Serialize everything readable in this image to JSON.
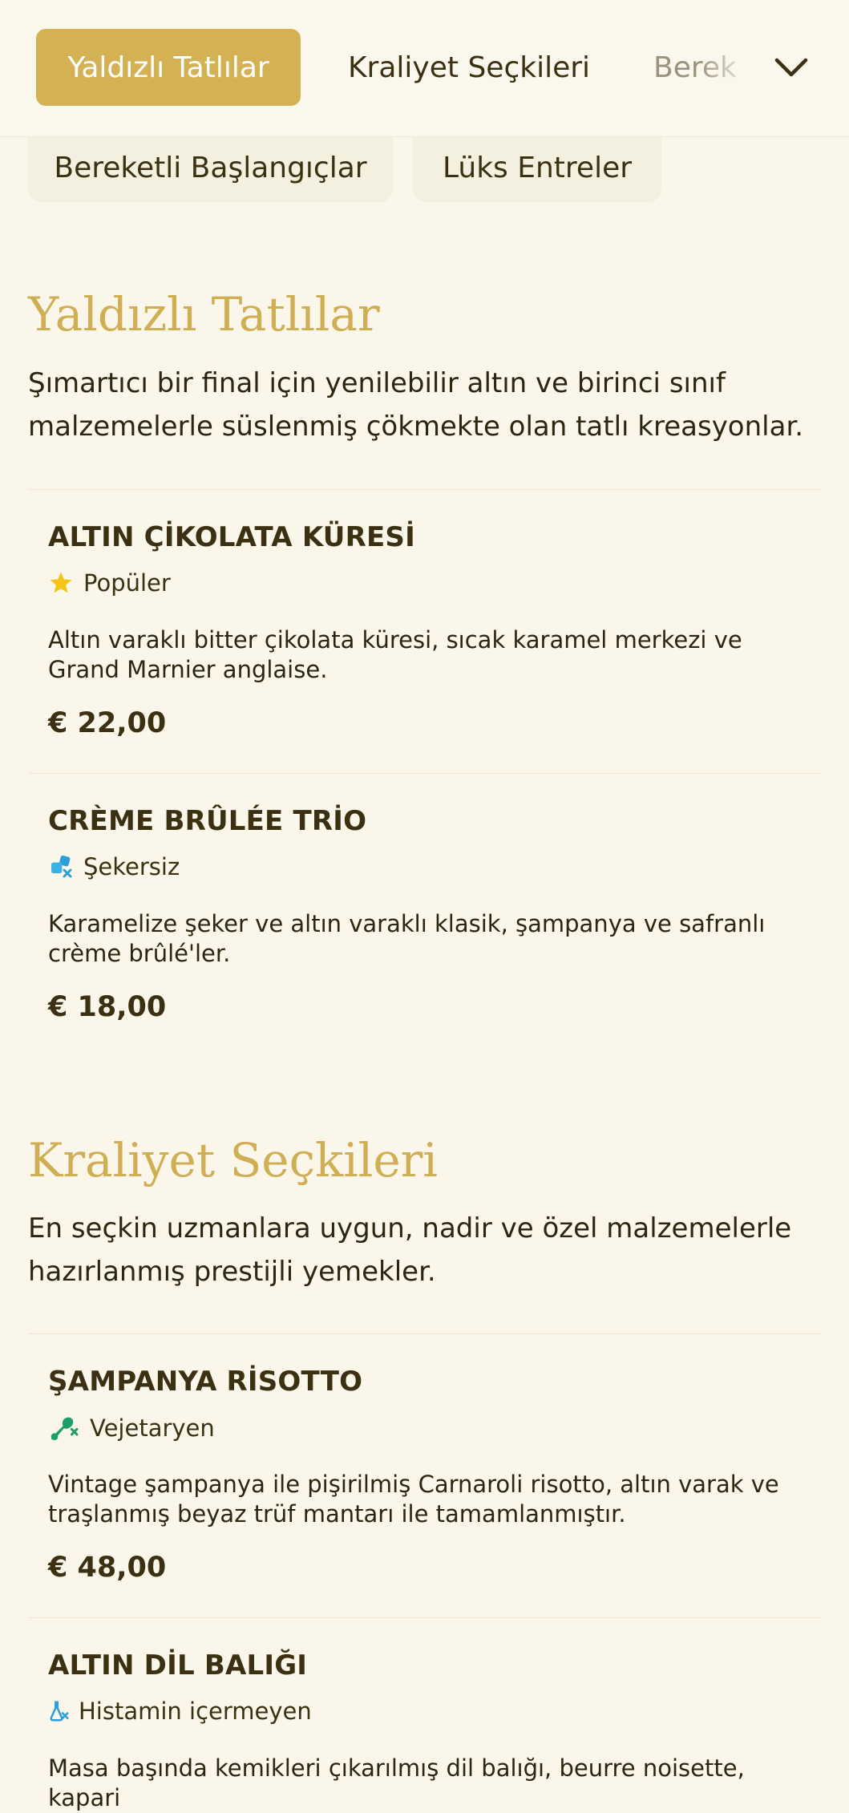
{
  "top_tabs": [
    {
      "label": "Yaldızlı Tatlılar",
      "active": true
    },
    {
      "label": "Kraliyet Seçkileri",
      "active": false
    },
    {
      "label": "Berek",
      "active": false
    }
  ],
  "top_tabs_overflow_icon": "chevron-down-icon",
  "sub_tabs": [
    {
      "label": "Bereketli Başlangıçlar"
    },
    {
      "label": "Lüks Entreler"
    }
  ],
  "colors": {
    "accent": "#d4b254",
    "title_gold": "#cfae54",
    "background": "#faf6ea",
    "text": "#3b3012"
  },
  "sections": [
    {
      "title": "Yaldızlı Tatlılar",
      "description": "Şımartıcı bir final için yenilebilir altın ve birinci sınıf malzemelerle süslenmiş çökmekte olan tatlı kreasyonlar.",
      "items": [
        {
          "name": "ALTIN ÇİKOLATA KÜRESİ",
          "tag": "Popüler",
          "tag_icon": "star-icon",
          "description": "Altın varaklı bitter çikolata küresi, sıcak karamel merkezi ve Grand Marnier anglaise.",
          "price": "€ 22,00"
        },
        {
          "name": "CRÈME BRÛLÉE TRİO",
          "tag": "Şekersiz",
          "tag_icon": "sugar-free-icon",
          "description": "Karamelize şeker ve altın varaklı klasik, şampanya ve safranlı crème brûlé'ler.",
          "price": "€ 18,00"
        }
      ]
    },
    {
      "title": "Kraliyet Seçkileri",
      "description": "En seçkin uzmanlara uygun, nadir ve özel malzemelerle hazırlanmış prestijli yemekler.",
      "items": [
        {
          "name": "ŞAMPANYA RİSOTTO",
          "tag": "Vejetaryen",
          "tag_icon": "no-meat-icon",
          "description": "Vintage şampanya ile pişirilmiş Carnaroli risotto, altın varak ve traşlanmış beyaz trüf mantarı ile tamamlanmıştır.",
          "price": "€ 48,00"
        },
        {
          "name": "ALTIN DİL BALIĞI",
          "tag": "Histamin içermeyen",
          "tag_icon": "histamine-free-icon",
          "description": "Masa başında kemikleri çıkarılmış dil balığı, beurre noisette, kapari"
        }
      ]
    }
  ]
}
